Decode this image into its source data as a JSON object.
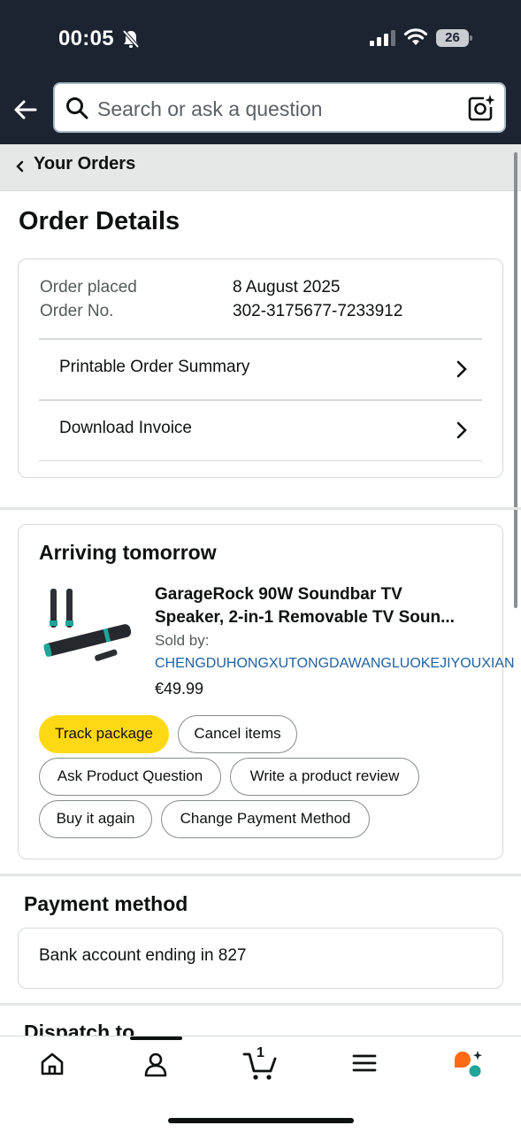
{
  "status_bar": {
    "time": "00:05",
    "battery": "26"
  },
  "search": {
    "placeholder": "Search or ask a question"
  },
  "breadcrumb": {
    "label": "Your Orders"
  },
  "page_title": "Order Details",
  "order": {
    "placed_label": "Order placed",
    "placed_value": "8 August 2025",
    "number_label": "Order No.",
    "number_value": "302-3175677-7233912",
    "links": [
      "Printable Order Summary",
      "Download Invoice"
    ]
  },
  "shipment": {
    "title": "Arriving tomorrow",
    "product_name_line1": "GarageRock 90W Soundbar TV",
    "product_name_line2": "Speaker, 2-in-1 Removable TV Soun...",
    "sold_by_label": "Sold by:",
    "seller": "CHENGDUHONGXUTONGDAWANGLUOKEJIYOUXIAN",
    "price": "€49.99",
    "buttons": {
      "track": "Track package",
      "cancel": "Cancel items",
      "ask": "Ask Product Question",
      "review": "Write a product review",
      "buy_again": "Buy it again",
      "change_payment": "Change Payment Method"
    }
  },
  "payment": {
    "title": "Payment method",
    "value": "Bank account ending in 827"
  },
  "dispatch": {
    "title": "Dispatch to"
  },
  "bottom_nav": {
    "cart_count": "1"
  },
  "colors": {
    "header": "#1c2331",
    "accent_yellow": "#ffd814",
    "link_blue": "#2162a1"
  },
  "icons": [
    "back-arrow-icon",
    "search-icon",
    "camera-icon",
    "chevron-right-icon",
    "home-icon",
    "account-icon",
    "cart-icon",
    "menu-icon",
    "rufus-ai-icon"
  ]
}
